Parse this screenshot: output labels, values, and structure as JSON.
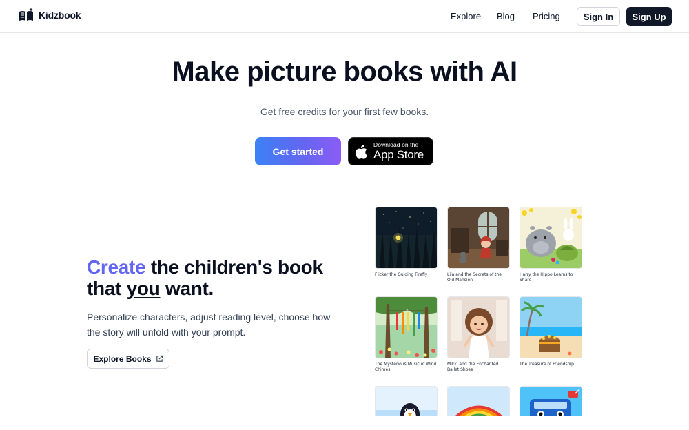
{
  "header": {
    "brand": "Kidzbook",
    "nav": [
      "Explore",
      "Blog",
      "Pricing"
    ],
    "signin_label": "Sign In",
    "signup_label": "Sign Up"
  },
  "hero": {
    "title": "Make picture books with AI",
    "subtitle": "Get free credits for your first few books.",
    "cta_label": "Get started",
    "appstore_small": "Download on the",
    "appstore_big": "App Store"
  },
  "feature": {
    "heading_accent": "Create",
    "heading_part1": " the children's book that ",
    "heading_underlined": "you",
    "heading_part2": " want.",
    "body": "Personalize characters, adjust reading level, choose how the story will unfold with your prompt.",
    "button_label": "Explore Books"
  },
  "books": [
    {
      "title": "Flicker the Guiding Firefly",
      "cover": "firefly-forest-night"
    },
    {
      "title": "Lila and the Secrets of the Old Mansion",
      "cover": "girl-in-mansion"
    },
    {
      "title": "Harry the Hippo Learns to Share",
      "cover": "hippo-and-friends"
    },
    {
      "title": "The Mysterious Music of Wind Chimes",
      "cover": "wind-chimes-garden"
    },
    {
      "title": "Mikki and the Enchanted Ballet Shoes",
      "cover": "girl-ballet"
    },
    {
      "title": "The Treasure of Friendship",
      "cover": "treasure-chest-beach"
    },
    {
      "title": "",
      "cover": "penguin"
    },
    {
      "title": "",
      "cover": "rainbow"
    },
    {
      "title": "",
      "cover": "blue-truck"
    }
  ],
  "colors": {
    "accent": "#6366f1",
    "dark": "#111827",
    "gradient_start": "#3b82f6",
    "gradient_end": "#8b5cf6"
  }
}
